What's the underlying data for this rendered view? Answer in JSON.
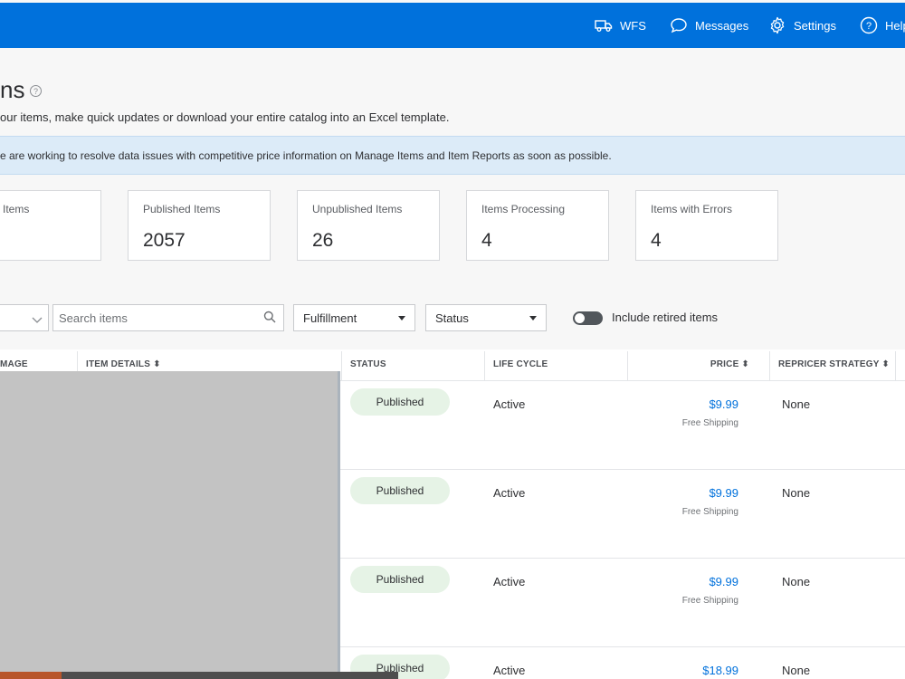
{
  "topnav": {
    "wfs": "WFS",
    "messages": "Messages",
    "settings": "Settings",
    "help": "Help"
  },
  "page": {
    "title": "ns",
    "subtitle": "our items, make quick updates or download your entire catalog into an Excel template.",
    "help_glyph": "?"
  },
  "notice": "e are working to resolve data issues with competitive price information on Manage Items and Item Reports as soon as possible.",
  "cards": [
    {
      "label": "Items",
      "value": ""
    },
    {
      "label": "Published Items",
      "value": "2057"
    },
    {
      "label": "Unpublished Items",
      "value": "26"
    },
    {
      "label": "Items Processing",
      "value": "4"
    },
    {
      "label": "Items with Errors",
      "value": "4"
    }
  ],
  "filters": {
    "search_placeholder": "Search items",
    "fulfillment": "Fulfillment",
    "status": "Status",
    "include_retired": "Include retired items"
  },
  "table": {
    "headers": {
      "image": "MAGE",
      "item_details": "ITEM DETAILS ⬍",
      "status": "STATUS",
      "life_cycle": "LIFE CYCLE",
      "price": "PRICE ⬍",
      "repricer": "REPRICER STRATEGY ⬍"
    },
    "rows": [
      {
        "status": "Published",
        "life_cycle": "Active",
        "price": "$9.99",
        "shipping": "Free Shipping",
        "strategy": "None"
      },
      {
        "status": "Published",
        "life_cycle": "Active",
        "price": "$9.99",
        "shipping": "Free Shipping",
        "strategy": "None"
      },
      {
        "status": "Published",
        "life_cycle": "Active",
        "price": "$9.99",
        "shipping": "Free Shipping",
        "strategy": "None"
      },
      {
        "status": "Published",
        "life_cycle": "Active",
        "price": "$18.99",
        "shipping": "",
        "strategy": "None"
      }
    ]
  }
}
